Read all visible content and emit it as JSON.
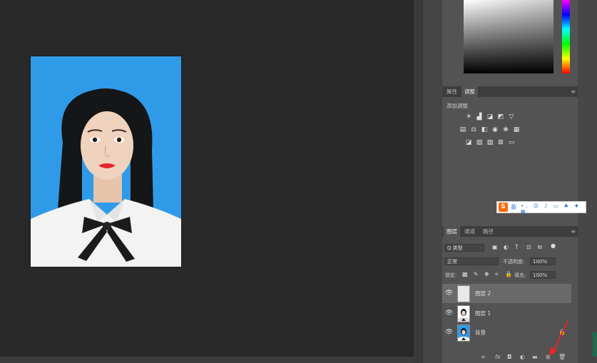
{
  "canvas": {
    "image_description_name": "id-photo"
  },
  "properties_panel": {
    "tabs": [
      {
        "label": "属性"
      },
      {
        "label": "调整"
      }
    ],
    "active_tab": 1,
    "add_adjustment_label": "添加调整",
    "rows": [
      [
        "brightness-icon",
        "levels-icon",
        "curves-icon",
        "exposure-icon",
        "triangle-icon"
      ],
      [
        "hue-icon",
        "balance-icon",
        "bw-icon",
        "photo-filter-icon",
        "channel-mixer-icon",
        "lookup-icon"
      ],
      [
        "invert-icon",
        "posterize-icon",
        "threshold-icon",
        "selective-color-icon",
        "gradient-map-icon"
      ]
    ]
  },
  "ime_bar": {
    "logo": "S",
    "lang": "英",
    "items": [
      "•,",
      "☺",
      "🎤",
      "▭",
      "♣",
      "👕",
      "▦"
    ]
  },
  "layers_panel": {
    "tabs": [
      {
        "label": "图层"
      },
      {
        "label": "通道"
      },
      {
        "label": "路径"
      }
    ],
    "active_tab": 0,
    "filter_label": "Q 类型",
    "blend_mode": "正常",
    "opacity_label": "不透明度:",
    "opacity_value": "100%",
    "lock_label": "锁定:",
    "fill_label": "填充:",
    "fill_value": "100%",
    "layers": [
      {
        "name": "图层 2",
        "type": "blank",
        "selected": true
      },
      {
        "name": "图层 1",
        "type": "photo",
        "selected": false
      },
      {
        "name": "背景",
        "type": "photo",
        "selected": false
      }
    ],
    "bottom_icons": [
      "link-icon",
      "fx-icon",
      "mask-icon",
      "adjustment-icon",
      "folder-icon",
      "new-layer-icon",
      "trash-icon"
    ]
  },
  "colors": {
    "photo_bg": "#2f9be8",
    "accent_red": "#e8242a",
    "selected_row": "#6a6a6a"
  }
}
